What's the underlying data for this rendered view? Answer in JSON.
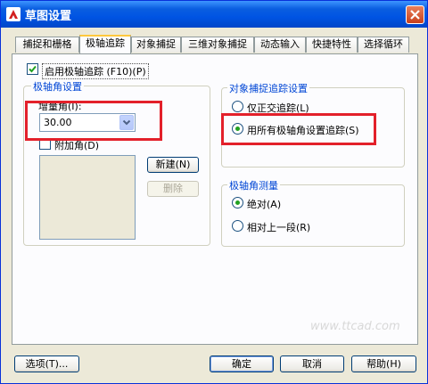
{
  "window": {
    "title": "草图设置"
  },
  "tabs": [
    {
      "label": "捕捉和栅格",
      "active": false
    },
    {
      "label": "极轴追踪",
      "active": true
    },
    {
      "label": "对象捕捉",
      "active": false
    },
    {
      "label": "三维对象捕捉",
      "active": false
    },
    {
      "label": "动态输入",
      "active": false
    },
    {
      "label": "快捷特性",
      "active": false
    },
    {
      "label": "选择循环",
      "active": false
    }
  ],
  "polar": {
    "enable_label": "启用极轴追踪 (F10)(P)",
    "enabled": true,
    "angle_group_title": "极轴角设置",
    "increment_label": "增量角(I):",
    "increment_value": "30.00",
    "additional_label": "附加角(D)",
    "additional_checked": false,
    "new_button": "新建(N)",
    "delete_button": "删除"
  },
  "snap_tracking": {
    "title": "对象捕捉追踪设置",
    "options": [
      {
        "label": "仅正交追踪(L)",
        "selected": false
      },
      {
        "label": "用所有极轴角设置追踪(S)",
        "selected": true
      }
    ]
  },
  "angle_measure": {
    "title": "极轴角测量",
    "options": [
      {
        "label": "绝对(A)",
        "selected": true
      },
      {
        "label": "相对上一段(R)",
        "selected": false
      }
    ]
  },
  "footer": {
    "options_button": "选项(T)...",
    "ok_button": "确定",
    "cancel_button": "取消",
    "help_button": "帮助(H)"
  },
  "watermark": "www.ttcad.com",
  "colors": {
    "highlight": "#e3202a",
    "group_title": "#0046d5",
    "radio_dot": "#21a121"
  }
}
